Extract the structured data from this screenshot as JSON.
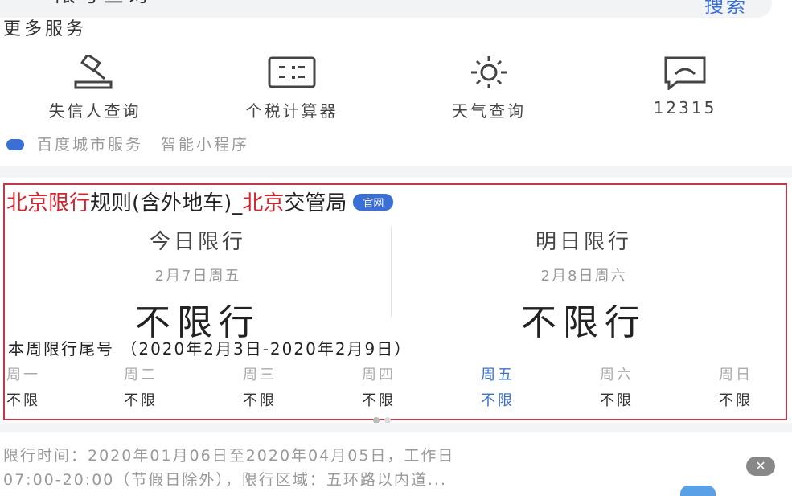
{
  "search": {
    "query": "限号查询",
    "button": "搜索"
  },
  "more_services": {
    "title": "更多服务",
    "items": [
      {
        "icon": "gavel-icon",
        "label": "失信人查询"
      },
      {
        "icon": "calculator-icon",
        "label": "个税计算器"
      },
      {
        "icon": "sun-icon",
        "label": "天气查询"
      },
      {
        "icon": "message-icon",
        "label": "12315"
      }
    ]
  },
  "platform": {
    "label": "百度城市服务",
    "sub": "智能小程序"
  },
  "card": {
    "title_hl1": "北京限行",
    "title_mid": "规则(含外地车)_",
    "title_hl2": "北京",
    "title_end": "交管局",
    "badge": "官网",
    "today": {
      "heading": "今日限行",
      "date": "2月7日周五",
      "status": "不限行"
    },
    "tomorrow": {
      "heading": "明日限行",
      "date": "2月8日周六",
      "status": "不限行"
    },
    "week_title": "本周限行尾号 （2020年2月3日-2020年2月9日）",
    "week": [
      {
        "day": "周一",
        "value": "不限"
      },
      {
        "day": "周二",
        "value": "不限"
      },
      {
        "day": "周三",
        "value": "不限"
      },
      {
        "day": "周四",
        "value": "不限"
      },
      {
        "day": "周五",
        "value": "不限"
      },
      {
        "day": "周六",
        "value": "不限"
      },
      {
        "day": "周日",
        "value": "不限"
      }
    ]
  },
  "description": {
    "line1": "限行时间：2020年01月06日至2020年04月05日，工作日",
    "line2": "07:00-20:00（节假日除外），限行区域：五环路以内道..."
  },
  "colors": {
    "accent": "#3a6fd6",
    "highlight": "#d4242e",
    "border": "#c0394b"
  }
}
